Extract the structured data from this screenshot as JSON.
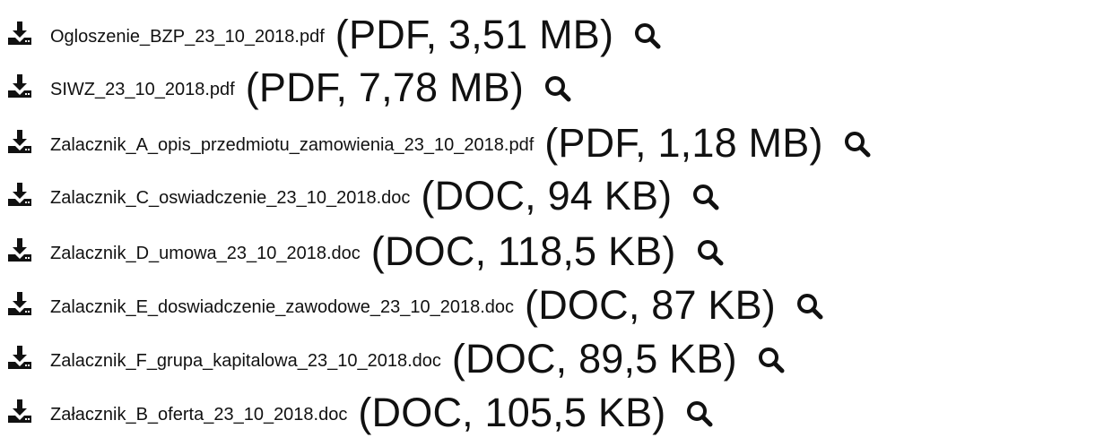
{
  "files": [
    {
      "name": "Ogloszenie_BZP_23_10_2018.pdf",
      "meta": "(PDF, 3,51 MB)",
      "download_icon": "download-icon",
      "preview_icon": "search-icon"
    },
    {
      "name": "SIWZ_23_10_2018.pdf",
      "meta": "(PDF, 7,78 MB)",
      "download_icon": "download-icon",
      "preview_icon": "search-icon"
    },
    {
      "name": "Zalacznik_A_opis_przedmiotu_zamowienia_23_10_2018.pdf",
      "meta": "(PDF, 1,18 MB)",
      "download_icon": "download-icon",
      "preview_icon": "search-icon"
    },
    {
      "name": "Zalacznik_C_oswiadczenie_23_10_2018.doc",
      "meta": "(DOC, 94 KB)",
      "download_icon": "download-icon",
      "preview_icon": "search-icon"
    },
    {
      "name": "Zalacznik_D_umowa_23_10_2018.doc",
      "meta": "(DOC, 118,5 KB)",
      "download_icon": "download-icon",
      "preview_icon": "search-icon"
    },
    {
      "name": "Zalacznik_E_doswiadczenie_zawodowe_23_10_2018.doc",
      "meta": "(DOC, 87 KB)",
      "download_icon": "download-icon",
      "preview_icon": "search-icon"
    },
    {
      "name": "Zalacznik_F_grupa_kapitalowa_23_10_2018.doc",
      "meta": "(DOC, 89,5 KB)",
      "download_icon": "download-icon",
      "preview_icon": "search-icon"
    },
    {
      "name": "Załacznik_B_oferta_23_10_2018.doc",
      "meta": "(DOC, 105,5 KB)",
      "download_icon": "download-icon",
      "preview_icon": "search-icon"
    }
  ],
  "colors": {
    "text": "#111111",
    "background": "#ffffff"
  }
}
